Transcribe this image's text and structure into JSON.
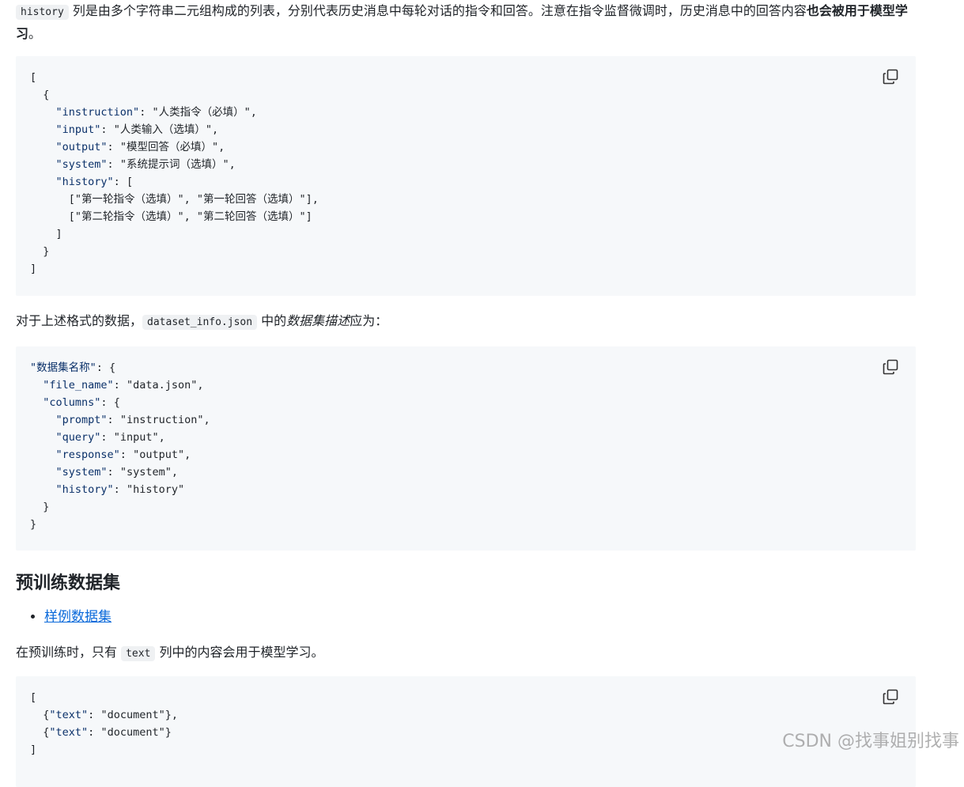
{
  "intro": {
    "code": "history",
    "text_before_bold": " 列是由多个字符串二元组构成的列表，分别代表历史消息中每轮对话的指令和回答。注意在指令监督微调时，历史消息中的回答内容",
    "bold": "也会被用于模型学习",
    "text_after": "。"
  },
  "code1": {
    "lines": [
      "[",
      "  {",
      "    \"instruction\": \"人类指令（必填）\",",
      "    \"input\": \"人类输入（选填）\",",
      "    \"output\": \"模型回答（必填）\",",
      "    \"system\": \"系统提示词（选填）\",",
      "    \"history\": [",
      "      [\"第一轮指令（选填）\", \"第一轮回答（选填）\"],",
      "      [\"第二轮指令（选填）\", \"第二轮回答（选填）\"]",
      "    ]",
      "  }",
      "]"
    ]
  },
  "para2": {
    "text_before": "对于上述格式的数据，",
    "code": "dataset_info.json",
    "text_mid": " 中的",
    "em": "数据集描述",
    "text_after": "应为："
  },
  "code2": {
    "lines": [
      "\"数据集名称\": {",
      "  \"file_name\": \"data.json\",",
      "  \"columns\": {",
      "    \"prompt\": \"instruction\",",
      "    \"query\": \"input\",",
      "    \"response\": \"output\",",
      "    \"system\": \"system\",",
      "    \"history\": \"history\"",
      "  }",
      "}"
    ]
  },
  "section": {
    "title": "预训练数据集"
  },
  "list": {
    "items": [
      "样例数据集"
    ]
  },
  "para3": {
    "text_before": "在预训练时，只有 ",
    "code": "text",
    "text_after": " 列中的内容会用于模型学习。"
  },
  "code3": {
    "lines": [
      "[",
      "  {\"text\": \"document\"},",
      "  {\"text\": \"document\"}",
      "]"
    ]
  },
  "watermark": "CSDN @找事姐别找事",
  "icons": {
    "copy": "copy-icon"
  }
}
